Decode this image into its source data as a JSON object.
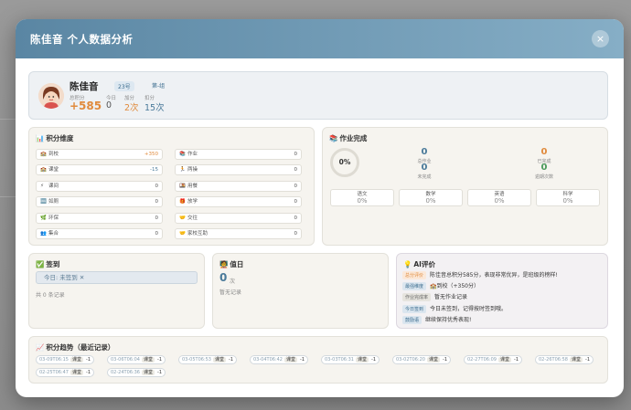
{
  "modal": {
    "title": "陈佳音 个人数据分析",
    "close": "×"
  },
  "profile": {
    "name": "陈佳音",
    "number": "23号",
    "group": "第-组",
    "stats": [
      {
        "label": "总积分",
        "value": "+585",
        "color": "#e08a3c"
      },
      {
        "label": "今日",
        "value": "0",
        "color": "#555555"
      },
      {
        "label": "加分",
        "value": "2次",
        "color": "#e08a3c"
      },
      {
        "label": "扣分",
        "value": "15次",
        "color": "#4a7a9a"
      }
    ]
  },
  "dimensions": {
    "title": "积分维度",
    "icon": "📊",
    "items": [
      {
        "icon": "🏫",
        "label": "到校",
        "value": "+350",
        "color": "#e08a3c"
      },
      {
        "icon": "📚",
        "label": "作业",
        "value": "0",
        "color": "#555555"
      },
      {
        "icon": "🏫",
        "label": "课堂",
        "value": "-15",
        "color": "#4a7a9a"
      },
      {
        "icon": "🏃",
        "label": "两操",
        "value": "0",
        "color": "#555555"
      },
      {
        "icon": "⚡",
        "label": "课间",
        "value": "0",
        "color": "#555555"
      },
      {
        "icon": "🍱",
        "label": "用餐",
        "value": "0",
        "color": "#555555"
      },
      {
        "icon": "🆒",
        "label": "如厕",
        "value": "0",
        "color": "#555555"
      },
      {
        "icon": "🎁",
        "label": "放学",
        "value": "0",
        "color": "#555555"
      },
      {
        "icon": "🌿",
        "label": "环保",
        "value": "0",
        "color": "#555555"
      },
      {
        "icon": "🤝",
        "label": "交往",
        "value": "0",
        "color": "#555555"
      },
      {
        "icon": "👥",
        "label": "集合",
        "value": "0",
        "color": "#555555"
      },
      {
        "icon": "🤝",
        "label": "家校互助",
        "value": "0",
        "color": "#555555"
      }
    ]
  },
  "homework": {
    "title": "作业完成",
    "icon": "📚",
    "rate": "0%",
    "stats": [
      {
        "value": "0",
        "label": "总作业",
        "color": "#4a7a9a"
      },
      {
        "value": "0",
        "label": "已完成",
        "color": "#e08a3c"
      },
      {
        "value": "0",
        "label": "未完成",
        "color": "#4a7a9a"
      },
      {
        "value": "0",
        "label": "逾期次数",
        "color": "#4a9a5a"
      }
    ],
    "subjects": [
      {
        "name": "语文",
        "value": "0%"
      },
      {
        "name": "数学",
        "value": "0%"
      },
      {
        "name": "英语",
        "value": "0%"
      },
      {
        "name": "科学",
        "value": "0%"
      }
    ]
  },
  "signin": {
    "title": "签到",
    "icon": "✅",
    "today": "今日: 未签到 ✕",
    "total": "共 0 条记录"
  },
  "duty": {
    "title": "值日",
    "icon": "🧑‍🏫",
    "count": "0",
    "unit": "次",
    "empty": "暂无记录"
  },
  "ai": {
    "title": "AI评价",
    "icon": "💡",
    "rows": [
      {
        "tag": "总分评价",
        "tag_color": "#e08a3c",
        "tag_bg": "#fbe8d8",
        "text": "陈佳音总积分585分，表现非常优异，是班级的榜样!"
      },
      {
        "tag": "最强维度",
        "tag_color": "#3b6c8e",
        "tag_bg": "#dbe6ef",
        "text": "🏫到校（+350分）"
      },
      {
        "tag": "作业完成率",
        "tag_color": "#666666",
        "tag_bg": "#e6e4de",
        "text": "暂无作业记录"
      },
      {
        "tag": "今日签到",
        "tag_color": "#3b6c8e",
        "tag_bg": "#dbe6ef",
        "text": "今日未签到，记得按时签到哦。"
      },
      {
        "tag": "鼓励语",
        "tag_color": "#3b6c8e",
        "tag_bg": "#dbe6ef",
        "text": "继续保持优秀表现!"
      }
    ]
  },
  "trend": {
    "title": "积分趋势（最近记录）",
    "icon": "📈",
    "records": [
      {
        "date": "03-09T06:15",
        "type": "课堂",
        "value": "-1"
      },
      {
        "date": "03-06T06:04",
        "type": "课堂",
        "value": "-1"
      },
      {
        "date": "03-05T06:53",
        "type": "课堂",
        "value": "-1"
      },
      {
        "date": "03-04T06:42",
        "type": "课堂",
        "value": "-1"
      },
      {
        "date": "03-03T06:31",
        "type": "课堂",
        "value": "-1"
      },
      {
        "date": "03-02T06:20",
        "type": "课堂",
        "value": "-1"
      },
      {
        "date": "02-27T06:09",
        "type": "课堂",
        "value": "-1"
      },
      {
        "date": "02-26T06:58",
        "type": "课堂",
        "value": "-1"
      },
      {
        "date": "02-25T06:47",
        "type": "课堂",
        "value": "-1"
      },
      {
        "date": "02-24T06:36",
        "type": "课堂",
        "value": "-1"
      }
    ]
  }
}
